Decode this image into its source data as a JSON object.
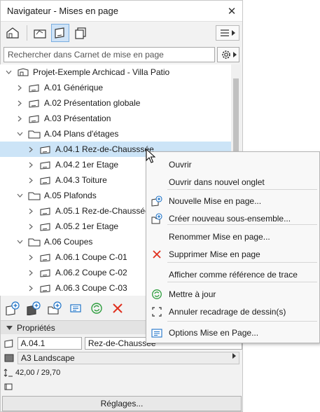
{
  "window": {
    "title": "Navigateur - Mises en page",
    "close_glyph": "✕"
  },
  "search": {
    "placeholder": "Rechercher dans Carnet de mise en page"
  },
  "tree": [
    {
      "label": "Projet-Exemple Archicad - Villa Patio",
      "level": 0,
      "kind": "project",
      "expander": "down"
    },
    {
      "label": "A.01 Générique",
      "level": 1,
      "kind": "layout",
      "expander": "right"
    },
    {
      "label": "A.02 Présentation globale",
      "level": 1,
      "kind": "layout",
      "expander": "right"
    },
    {
      "label": "A.03 Présentation",
      "level": 1,
      "kind": "layout",
      "expander": "right"
    },
    {
      "label": "A.04 Plans d'étages",
      "level": 1,
      "kind": "folder",
      "expander": "down"
    },
    {
      "label": "A.04.1 Rez-de-Chausssée",
      "level": 2,
      "kind": "layout",
      "expander": "right",
      "selected": true
    },
    {
      "label": "A.04.2 1er Etage",
      "level": 2,
      "kind": "layout",
      "expander": "right"
    },
    {
      "label": "A.04.3 Toiture",
      "level": 2,
      "kind": "layout",
      "expander": "right"
    },
    {
      "label": "A.05 Plafonds",
      "level": 1,
      "kind": "folder",
      "expander": "down"
    },
    {
      "label": "A.05.1 Rez-de-Chaussée",
      "level": 2,
      "kind": "layout",
      "expander": "right"
    },
    {
      "label": "A.05.2 1er Etage",
      "level": 2,
      "kind": "layout",
      "expander": "right"
    },
    {
      "label": "A.06 Coupes",
      "level": 1,
      "kind": "folder",
      "expander": "down"
    },
    {
      "label": "A.06.1 Coupe C-01",
      "level": 2,
      "kind": "layout",
      "expander": "right"
    },
    {
      "label": "A.06.2 Coupe C-02",
      "level": 2,
      "kind": "layout",
      "expander": "right"
    },
    {
      "label": "A.06.3 Coupe C-03",
      "level": 2,
      "kind": "layout",
      "expander": "right"
    }
  ],
  "properties": {
    "header": "Propriétés",
    "id": "A.04.1",
    "name": "Rez-de-Chaussée",
    "format": "A3 Landscape",
    "size": "42,00 / 29,70",
    "settings_button": "Réglages..."
  },
  "context_menu": [
    {
      "label": "Ouvrir",
      "icon": "none"
    },
    {
      "label": "Ouvrir dans nouvel onglet",
      "icon": "none"
    },
    {
      "label": "Nouvelle Mise en page...",
      "icon": "new-layout-icon"
    },
    {
      "label": "Créer nouveau sous-ensemble...",
      "icon": "new-subset-icon"
    },
    {
      "label": "Renommer Mise en page...",
      "icon": "none"
    },
    {
      "label": "Supprimer Mise en page",
      "icon": "delete-icon"
    },
    {
      "label": "Afficher comme référence de trace",
      "icon": "none"
    },
    {
      "label": "Mettre à jour",
      "icon": "update-icon"
    },
    {
      "label": "Annuler recadrage de dessin(s)",
      "icon": "crop-icon"
    },
    {
      "label": "Options Mise en Page...",
      "icon": "layout-options-icon"
    }
  ],
  "colors": {
    "selection": "#cce4f7",
    "accent_blue": "#1e73c8",
    "delete_red": "#e0301e",
    "update_green": "#2e9e3e"
  }
}
